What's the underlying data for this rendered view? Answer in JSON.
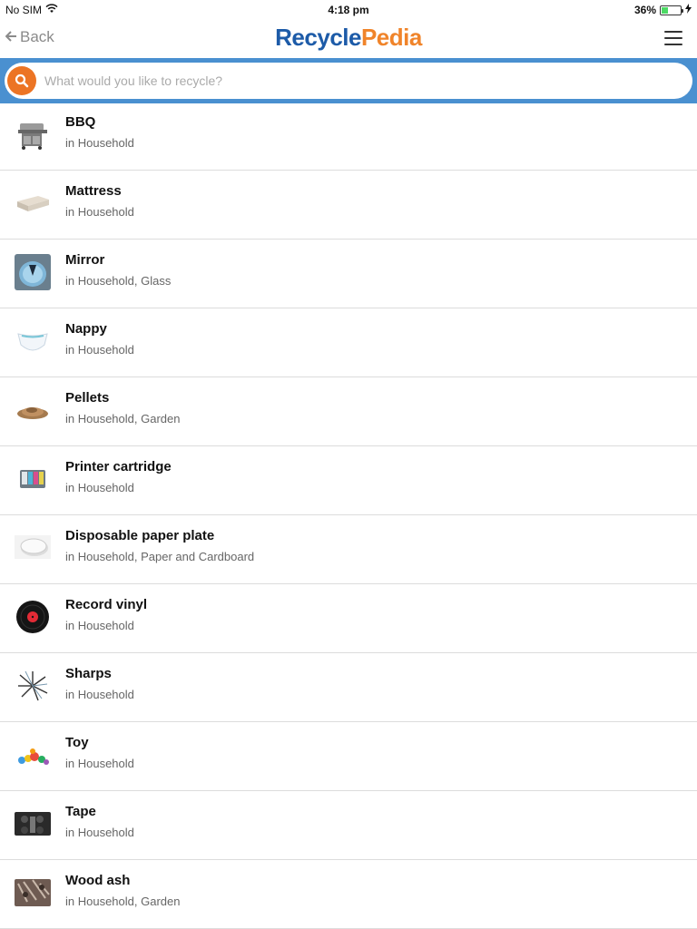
{
  "status_bar": {
    "carrier": "No SIM",
    "time": "4:18 pm",
    "battery": "36%",
    "battery_level": 0.36,
    "wifi_icon": "wifi-icon",
    "charging_icon": "bolt-icon"
  },
  "nav": {
    "back_label": "Back",
    "logo_part1": "Recycle",
    "logo_part2": "Pedia",
    "menu_icon": "hamburger-menu-icon"
  },
  "search": {
    "placeholder": "What would you like to recycle?",
    "value": ""
  },
  "colors": {
    "brand_blue": "#1d5ba8",
    "brand_orange": "#f0842a",
    "search_bar_bg": "#4a90d0",
    "search_icon_bg": "#ec7424"
  },
  "items": [
    {
      "title": "BBQ",
      "subtitle": "in Household",
      "icon": "bbq-grill-icon"
    },
    {
      "title": "Mattress",
      "subtitle": "in Household",
      "icon": "mattress-icon"
    },
    {
      "title": "Mirror",
      "subtitle": "in Household, Glass",
      "icon": "mirror-icon"
    },
    {
      "title": "Nappy",
      "subtitle": "in Household",
      "icon": "nappy-icon"
    },
    {
      "title": "Pellets",
      "subtitle": "in Household, Garden",
      "icon": "pellets-icon"
    },
    {
      "title": "Printer cartridge",
      "subtitle": "in Household",
      "icon": "printer-cartridge-icon"
    },
    {
      "title": "Disposable paper plate",
      "subtitle": "in Household, Paper and Cardboard",
      "icon": "paper-plate-icon"
    },
    {
      "title": "Record vinyl",
      "subtitle": "in Household",
      "icon": "vinyl-record-icon"
    },
    {
      "title": "Sharps",
      "subtitle": "in Household",
      "icon": "sharps-icon"
    },
    {
      "title": "Toy",
      "subtitle": "in Household",
      "icon": "toy-icon"
    },
    {
      "title": "Tape",
      "subtitle": "in Household",
      "icon": "tape-icon"
    },
    {
      "title": "Wood ash",
      "subtitle": "in Household, Garden",
      "icon": "wood-ash-icon"
    }
  ]
}
